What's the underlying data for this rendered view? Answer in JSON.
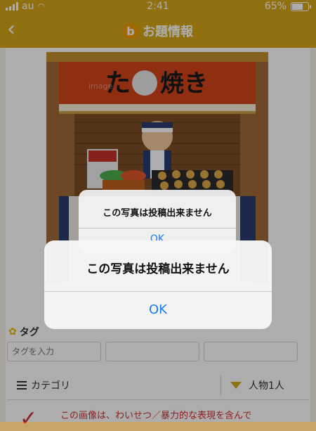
{
  "status": {
    "carrier": "au",
    "time": "2:41",
    "battery": "65%"
  },
  "header": {
    "back_icon": "‹",
    "logo_letter": "b",
    "title": "お題情報"
  },
  "photo": {
    "sign_text_left": "た",
    "sign_text_right": "焼き",
    "watermark": "image"
  },
  "tags": {
    "label": "タグ",
    "placeholder_1": "タグを入力",
    "placeholder_2": "",
    "placeholder_3": ""
  },
  "category": {
    "label": "カテゴリ",
    "value": "人物1人"
  },
  "warning": {
    "text": "この画像は、わいせつ／暴力的な表現を含んで"
  },
  "alert_back": {
    "message": "この写真は投稿出来ません",
    "ok": "OK"
  },
  "alert": {
    "message": "この写真は投稿出来ません",
    "ok": "OK"
  },
  "colors": {
    "header": "#d5a617",
    "accent_blue": "#1a7cf5",
    "warning_red": "#d12f2f"
  }
}
